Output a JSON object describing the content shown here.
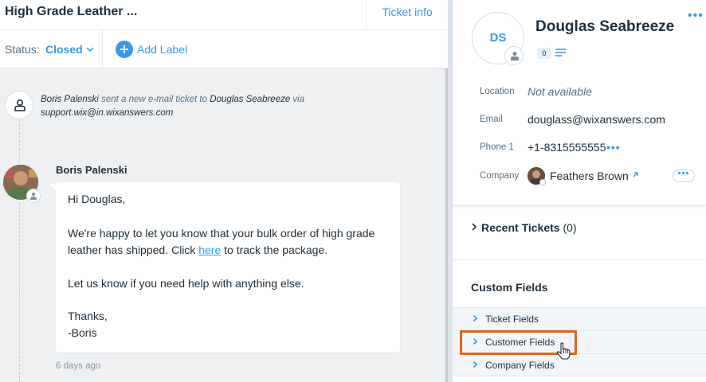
{
  "ticket": {
    "title": "High Grade Leather ...",
    "info_tab": "Ticket info",
    "status_label": "Status:",
    "status_value": "Closed",
    "add_label": "Add Label"
  },
  "timeline": {
    "system_actor": "Boris Palenski",
    "system_action": " sent a new e-mail ticket to ",
    "system_target": "Douglas Seabreeze",
    "system_via": " via",
    "system_address": "support.wix@in.wixanswers.com"
  },
  "message": {
    "sender": "Boris Palenski",
    "greeting": "Hi Douglas,",
    "body_pre": "We're happy to let you know that your bulk order of high grade leather has shipped. Click ",
    "link_text": "here",
    "body_post": " to track the package.",
    "help": "Let us know if you need help with anything else.",
    "thanks": "Thanks,",
    "signoff": "-Boris",
    "timestamp": "6 days ago"
  },
  "contact": {
    "initials": "DS",
    "name": "Douglas Seabreeze",
    "count": "0",
    "location_label": "Location",
    "location_value": "Not available",
    "email_label": "Email",
    "email_value": "douglass@wixanswers.com",
    "phone_label": "Phone 1",
    "phone_value": "+1-8315555555",
    "company_label": "Company",
    "company_value": "Feathers Brown"
  },
  "recent_tickets": {
    "label": "Recent Tickets",
    "count": "(0)"
  },
  "custom_fields": {
    "title": "Custom Fields",
    "rows": [
      "Ticket Fields",
      "Customer Fields",
      "Company Fields"
    ]
  },
  "colors": {
    "accent": "#3899ec",
    "highlight": "#e0641e",
    "text": "#20303c",
    "muted": "#577083"
  }
}
